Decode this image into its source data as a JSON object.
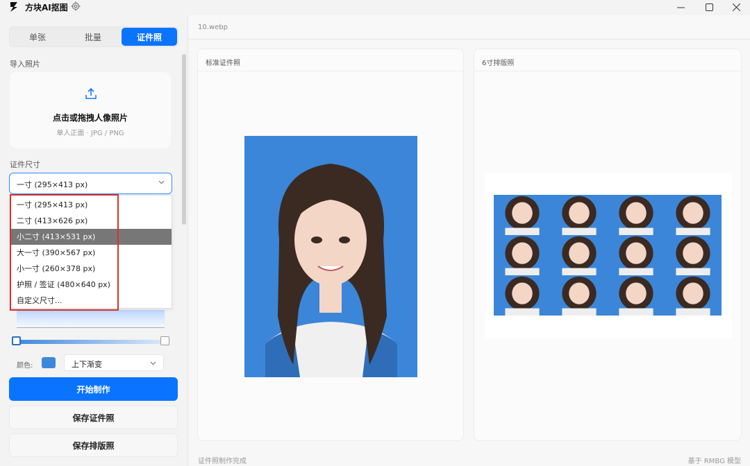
{
  "window": {
    "title": "方块AI抠图",
    "controls": [
      "minimize",
      "maximize",
      "close"
    ]
  },
  "sidebar": {
    "tabs": [
      {
        "label": "单张",
        "active": false
      },
      {
        "label": "批量",
        "active": false
      },
      {
        "label": "证件照",
        "active": true
      }
    ],
    "import_label": "导入照片",
    "upload": {
      "title": "点击或拖拽人像照片",
      "subtitle": "单人正面 · JPG / PNG"
    },
    "size_label": "证件尺寸",
    "size_select": {
      "value": "一寸 (295×413 px)",
      "options": [
        {
          "label": "一寸 (295×413 px)",
          "highlighted": false
        },
        {
          "label": "二寸 (413×626 px)",
          "highlighted": false
        },
        {
          "label": "小二寸 (413×531 px)",
          "highlighted": true
        },
        {
          "label": "大一寸 (390×567 px)",
          "highlighted": false
        },
        {
          "label": "小一寸 (260×378 px)",
          "highlighted": false
        },
        {
          "label": "护照 / 签证 (480×640 px)",
          "highlighted": false
        },
        {
          "label": "自定义尺寸...",
          "highlighted": false
        }
      ]
    },
    "background": {
      "color_label": "颜色:",
      "color": "#3e88dc",
      "gradient_mode": "上下渐变"
    },
    "buttons": {
      "start": "开始制作",
      "save_photo": "保存证件照",
      "save_layout": "保存排版照"
    }
  },
  "main": {
    "file_name": "10.webp",
    "panels": {
      "standard_title": "标准证件照",
      "layout_title": "6寸排版照"
    },
    "layout_grid": {
      "rows": 3,
      "cols": 4
    },
    "status_left": "证件照制作完成",
    "status_right": "基于 RMBG 模型"
  },
  "colors": {
    "accent": "#0a74ff",
    "photo_bg": "#3b86d8",
    "highlight_box": "#d9302c"
  }
}
